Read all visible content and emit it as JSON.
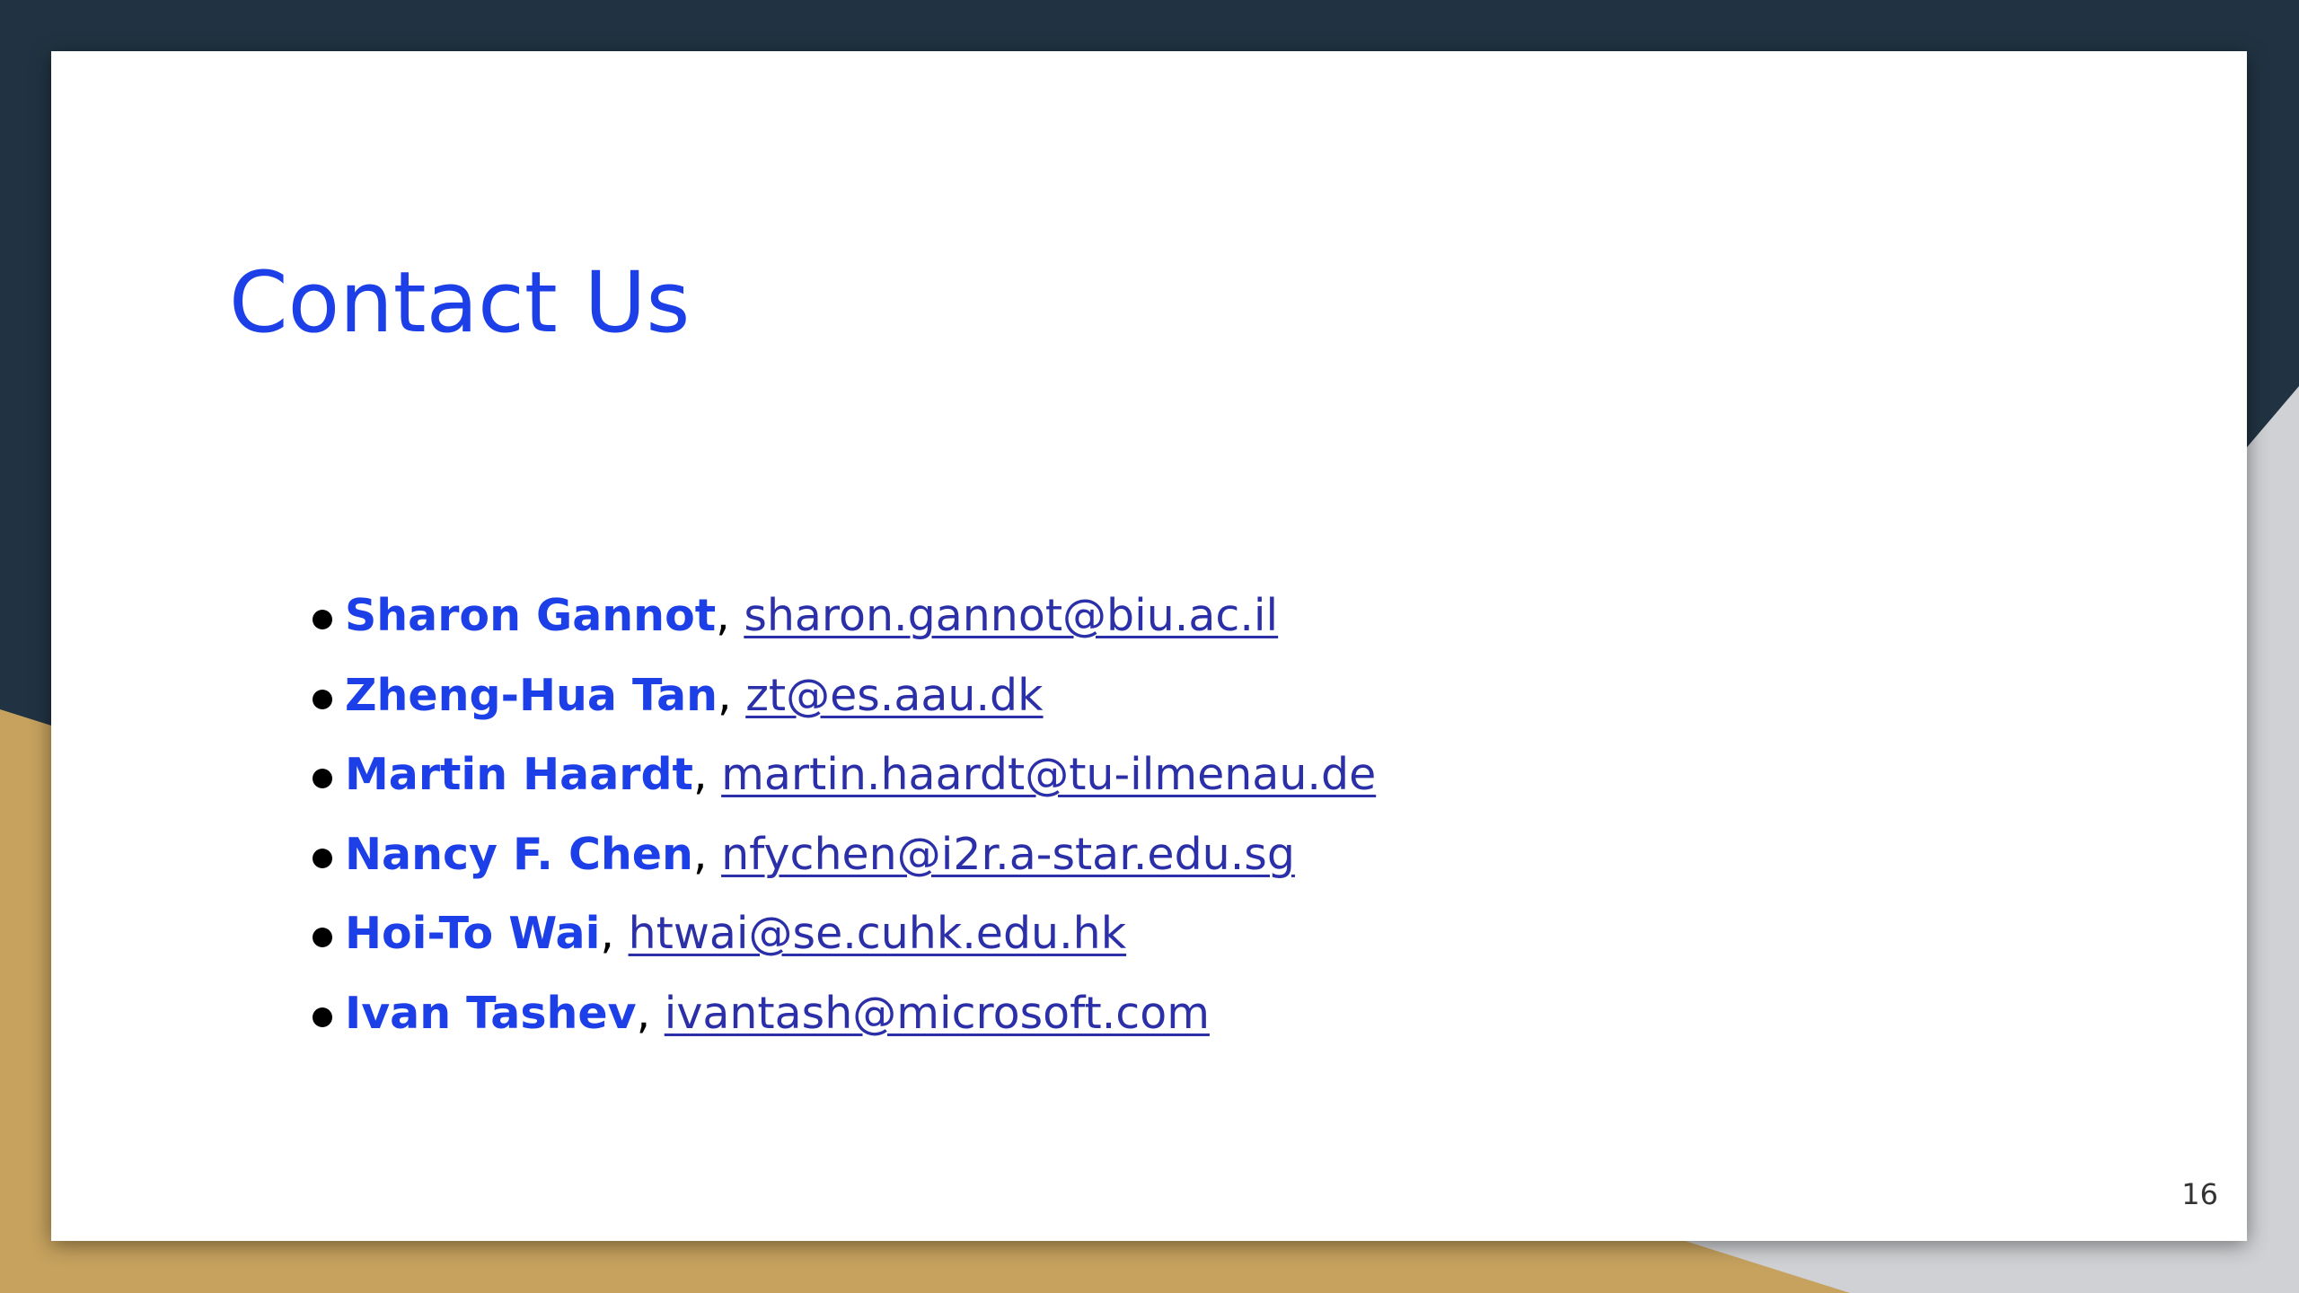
{
  "slide": {
    "title": "Contact Us",
    "page_number": "16",
    "contacts": [
      {
        "name": "Sharon Gannot",
        "separator": ",",
        "email": "sharon.gannot@biu.ac.il"
      },
      {
        "name": "Zheng-Hua Tan",
        "separator": ",",
        "email": "zt@es.aau.dk"
      },
      {
        "name": "Martin Haardt",
        "separator": ",",
        "email": "martin.haardt@tu-ilmenau.de"
      },
      {
        "name": "Nancy F. Chen",
        "separator": ",",
        "email": "nfychen@i2r.a-star.edu.sg"
      },
      {
        "name": "Hoi-To Wai",
        "separator": ",",
        "email": "htwai@se.cuhk.edu.hk"
      },
      {
        "name": "Ivan Tashev",
        "separator": ",",
        "email": "ivantash@microsoft.com"
      }
    ]
  },
  "colors": {
    "title": "#1c3fe8",
    "name": "#1c3fe8",
    "link": "#2b2fa8",
    "background_dark": "#213342",
    "background_gold": "#c6a25e",
    "background_gray": "#cfd1d4"
  }
}
